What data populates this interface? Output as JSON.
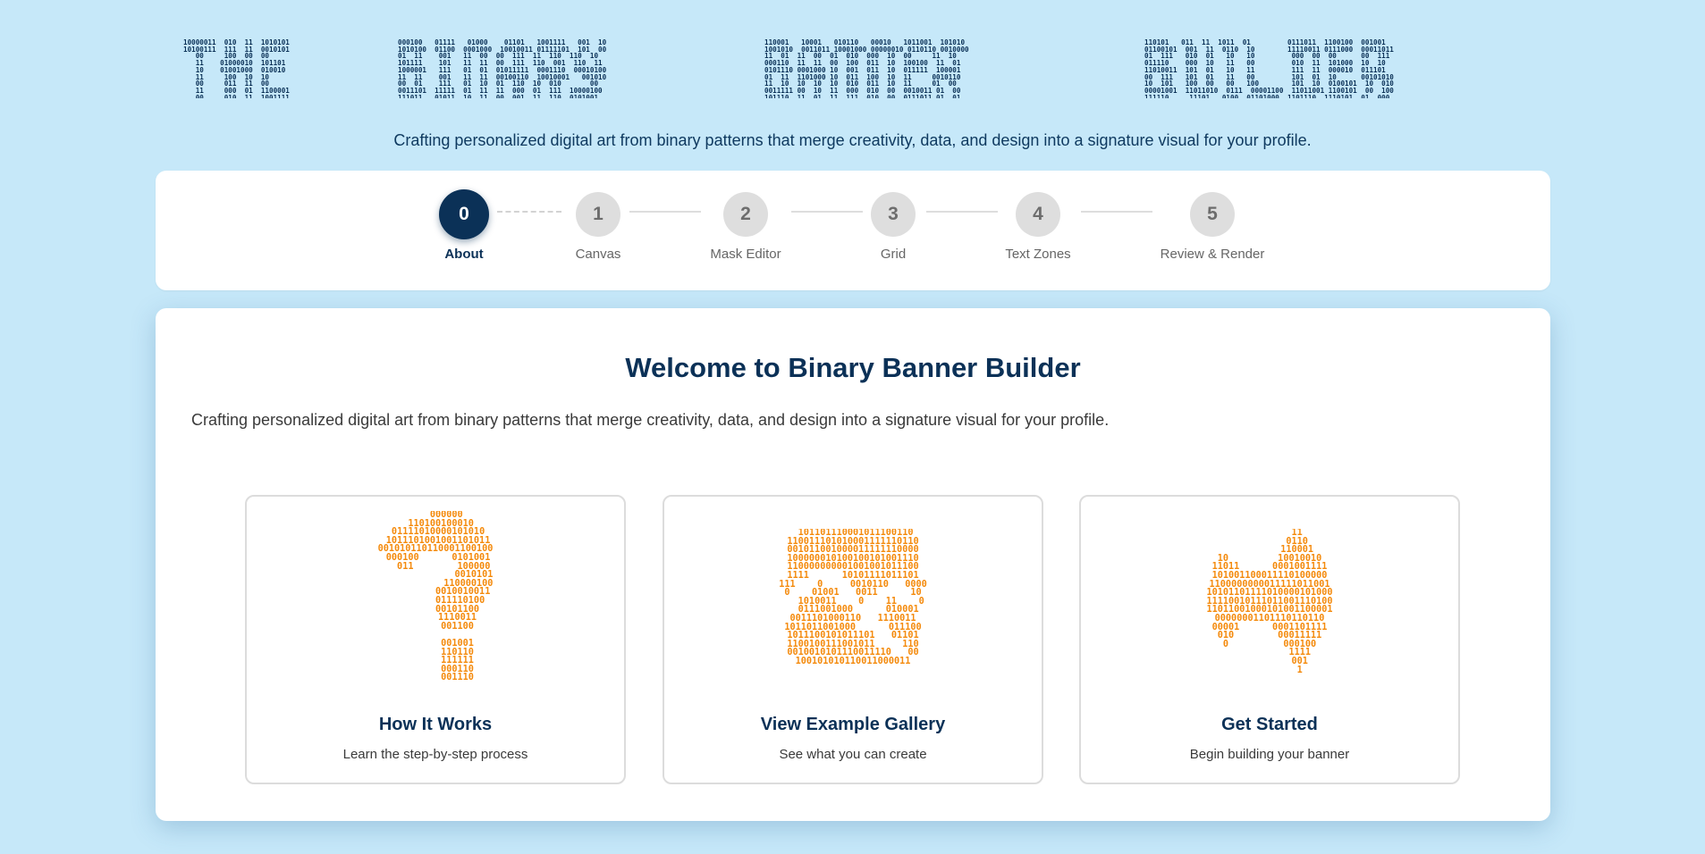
{
  "hero": {
    "words": [
      {
        "rows": [
          "10000011  010  11  1010101",
          "10100111  111  11  0010101",
          "   00     100  00  00",
          "   11    01000010  101101",
          "   10    01001000  010010",
          "   11     100  10  10",
          "   00     011  11  00",
          "   11     000  01  1100001",
          "   00     010  11  1001111"
        ]
      },
      {
        "rows": [
          "000100   01111   01000    01101   1001111   001  10",
          "1010100  01100  0001000  10010011 01111101  101  00",
          "01  11    001   11  00  00  111  11  110  110  10",
          "101111    101   11  11  00  111  110  001  110  11",
          "1000001   111   01  01  01011111  0001110  00010100",
          "11  11    001   11  11  00100110  10010001   001010",
          "00  01    111   01  10  01  110  10  010       00",
          "0011101  11111  01  11  11  000  01  111  10000100",
          "111011   01011  10  11  00  001  11  110  0101001"
        ]
      },
      {
        "rows": [
          "110001   10001   010110   00010   1011001  101010",
          "1001010  0011011 10001000 00000010 0110110 0010000",
          "11  01  11  00  01  010  000  10  00     11  10",
          "000110  11  11  00  100  011  10  100100  11  01",
          "0101110 0001000 10  001  011  10  011111  100001",
          "01  11  1101000 10  011  100  10  11     0010110",
          "11  10  10  10  10  010  011  10  11     01  00",
          "0011111 00  10  11  000  010  00  0010011 01  00",
          "101110  11  01  11  111  010  00  0111011 01  01"
        ]
      },
      {
        "rows": [
          "110101   011  11  1011  01         0111011  1100100  001001",
          "01100101  001  11  0110  10        11110011 0111000  00011011",
          "01  111   010  01   10   10         000  00  00      00  111",
          "011110    000  10   11   00         010  11  101000  10  10",
          "11010011  101  01   10   11         111  11  000010  011101",
          "00  111   101  01   11   00         101  01  10      00101010",
          "10  101   100  00   00   100        101  10  0100101  10  010",
          "00001001  11011010  0111  00001100  11011001 1100101  00  100",
          "111110     11101   0100  01101000  1101110  1110101  01  000"
        ]
      }
    ]
  },
  "tagline": "Crafting personalized digital art from binary patterns that merge creativity, data, and design into a signature visual for your profile.",
  "stepper": {
    "steps": [
      {
        "num": "0",
        "label": "About"
      },
      {
        "num": "1",
        "label": "Canvas"
      },
      {
        "num": "2",
        "label": "Mask Editor"
      },
      {
        "num": "3",
        "label": "Grid"
      },
      {
        "num": "4",
        "label": "Text Zones"
      },
      {
        "num": "5",
        "label": "Review & Render"
      }
    ],
    "active_index": 0
  },
  "main": {
    "title": "Welcome to Binary Banner Builder",
    "description": "Crafting personalized digital art from binary patterns that merge creativity, data, and design into a signature visual for your profile.",
    "options": [
      {
        "icon": "question-mark-icon",
        "title": "How It Works",
        "subtitle": "Learn the step-by-step process",
        "art": [
          "    000000",
          "  110100100010",
          " 01111010000101010",
          " 1011101001001101011",
          "001010110110001100100",
          " 000100      0101001",
          "   011        100000",
          "              0010101",
          "            110000100",
          "          0010010011",
          "         011110100",
          "        00101100",
          "        1110011",
          "        001100",
          "",
          "        001001",
          "        110110",
          "        111111",
          "        000110",
          "        001110"
        ]
      },
      {
        "icon": "image-gallery-icon",
        "title": "View Example Gallery",
        "subtitle": "See what you can create",
        "art": [
          " 101101110001011100110",
          "110011101010001111110110",
          "001011001000011111110000",
          "100000010100100101001110",
          "110000000001001001011100",
          "1111      10101111011101",
          "111    0     0010110   0000",
          "0    01001   0011      10",
          "   1010011    0    11    0",
          "  0111001000      010001",
          "0011101000110   1110011",
          "1011011001000      011100",
          "1011100101011101   01101",
          "1100100111001011     110",
          "0010010101110011110   00",
          "100101010110011000011"
        ]
      },
      {
        "icon": "arrow-right-icon",
        "title": "Get Started",
        "subtitle": "Begin building your banner",
        "art": [
          "          11",
          "          0110",
          "          110001",
          "10         10010010",
          "11011      0001001111",
          "101001100011110100000",
          "1100000000011111011001",
          "10101101111010000101000",
          "11110010111011001110100",
          "11011001000101001100001",
          "00000001101110110110",
          "00001      0001101111",
          "010        00011111",
          "0          000100",
          "           1111",
          "           001",
          "           1"
        ]
      }
    ]
  }
}
